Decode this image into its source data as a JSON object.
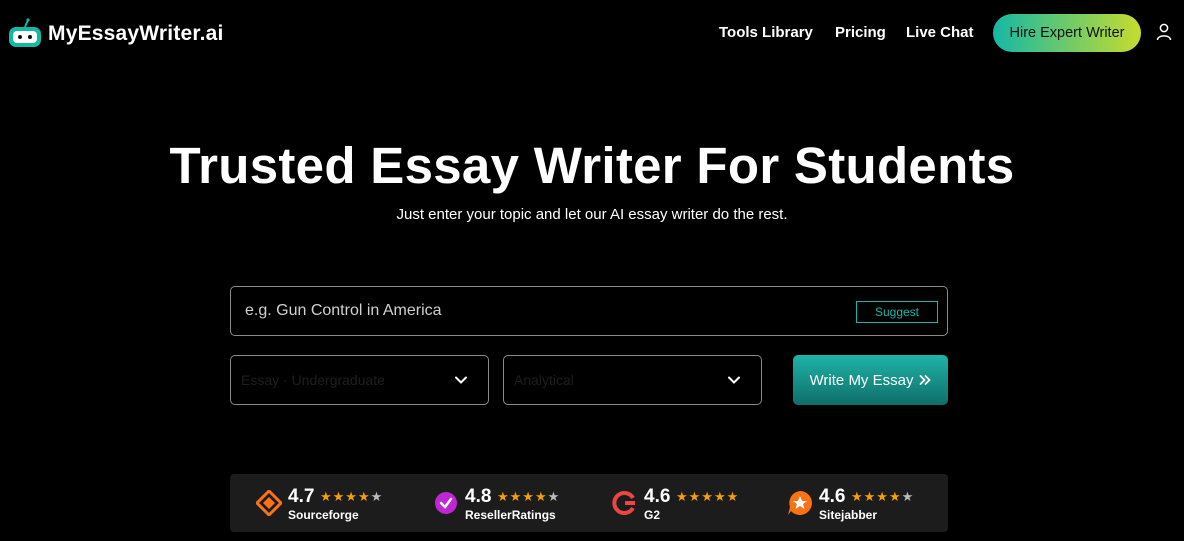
{
  "header": {
    "logo_text": "MyEssayWriter.ai",
    "nav": [
      "Tools Library",
      "Pricing",
      "Live Chat"
    ],
    "hire_button": "Hire Expert Writer",
    "user_icon": "user-icon"
  },
  "hero": {
    "title": "Trusted Essay Writer For Students",
    "subtitle": "Just enter your topic and let our AI essay writer do the rest."
  },
  "form": {
    "topic_placeholder": "e.g. Gun Control in America",
    "topic_value": "",
    "suggest_label": "Suggest",
    "level_select": "Essay · Undergraduate",
    "type_select": "Analytical",
    "write_button": "Write My Essay"
  },
  "ratings": [
    {
      "score": "4.7",
      "name": "Sourceforge",
      "stars": "★★★★",
      "half": "★",
      "icon": "sourceforge-icon",
      "color": "#f97316"
    },
    {
      "score": "4.8",
      "name": "ResellerRatings",
      "stars": "★★★★",
      "half": "★",
      "icon": "resellerratings-icon",
      "color": "#c026d3"
    },
    {
      "score": "4.6",
      "name": "G2",
      "stars": "★★★★★",
      "half": "",
      "icon": "g2-icon",
      "color": "#ef4444"
    },
    {
      "score": "4.6",
      "name": "Sitejabber",
      "stars": "★★★★",
      "half": "★",
      "icon": "sitejabber-icon",
      "color": "#f97316"
    }
  ],
  "colors": {
    "accent": "#14b8a6",
    "background": "#000000",
    "star": "#f59e0b"
  }
}
